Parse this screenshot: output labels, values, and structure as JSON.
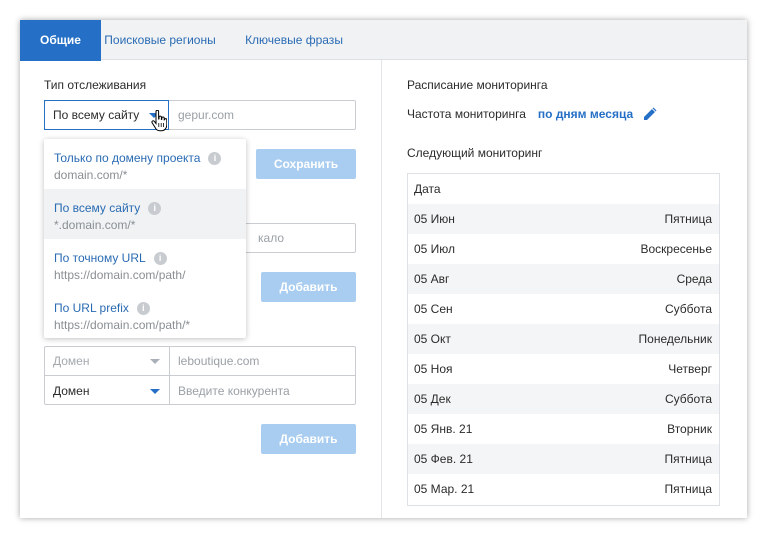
{
  "tabs": [
    {
      "label": "Общие",
      "active": true
    },
    {
      "label": "Поисковые регионы",
      "active": false
    },
    {
      "label": "Ключевые фразы",
      "active": false
    }
  ],
  "tracking": {
    "label": "Тип отслеживания",
    "selected": "По всему сайту",
    "domain_value": "gepur.com",
    "save_label": "Сохранить"
  },
  "dropdown": {
    "items": [
      {
        "title": "Только по домену проекта",
        "example": "domain.com/*",
        "hovered": false
      },
      {
        "title": "По всему сайту",
        "example": "*.domain.com/*",
        "hovered": true
      },
      {
        "title": "По точному URL",
        "example": "https://domain.com/path/",
        "hovered": false
      },
      {
        "title": "По URL prefix",
        "example": "https://domain.com/path/*",
        "hovered": false
      }
    ]
  },
  "partial_input": {
    "placeholder_tail": "кало"
  },
  "add_label_1": "Добавить",
  "competitors": {
    "row1": {
      "type": "Домен",
      "value": "leboutique.com"
    },
    "row2": {
      "type": "Домен",
      "placeholder": "Введите конкурента"
    },
    "add_label": "Добавить"
  },
  "schedule": {
    "title": "Расписание мониторинга",
    "freq_label": "Частота мониторинга",
    "freq_value": "по дням месяца",
    "next_title": "Следующий мониторинг",
    "header": "Дата",
    "rows": [
      {
        "date": "05 Июн",
        "day": "Пятница"
      },
      {
        "date": "05 Июл",
        "day": "Воскресенье"
      },
      {
        "date": "05 Авг",
        "day": "Среда"
      },
      {
        "date": "05 Сен",
        "day": "Суббота"
      },
      {
        "date": "05 Окт",
        "day": "Понедельник"
      },
      {
        "date": "05 Ноя",
        "day": "Четверг"
      },
      {
        "date": "05 Дек",
        "day": "Суббота"
      },
      {
        "date": "05 Янв. 21",
        "day": "Вторник"
      },
      {
        "date": "05 Фев. 21",
        "day": "Пятница"
      },
      {
        "date": "05 Мар. 21",
        "day": "Пятница"
      }
    ]
  },
  "colors": {
    "accent": "#2570c6",
    "button_disabled": "#a9cdf0"
  },
  "icons": {
    "info": "info-icon",
    "edit": "pencil-icon",
    "cursor": "hand-pointer-icon"
  }
}
